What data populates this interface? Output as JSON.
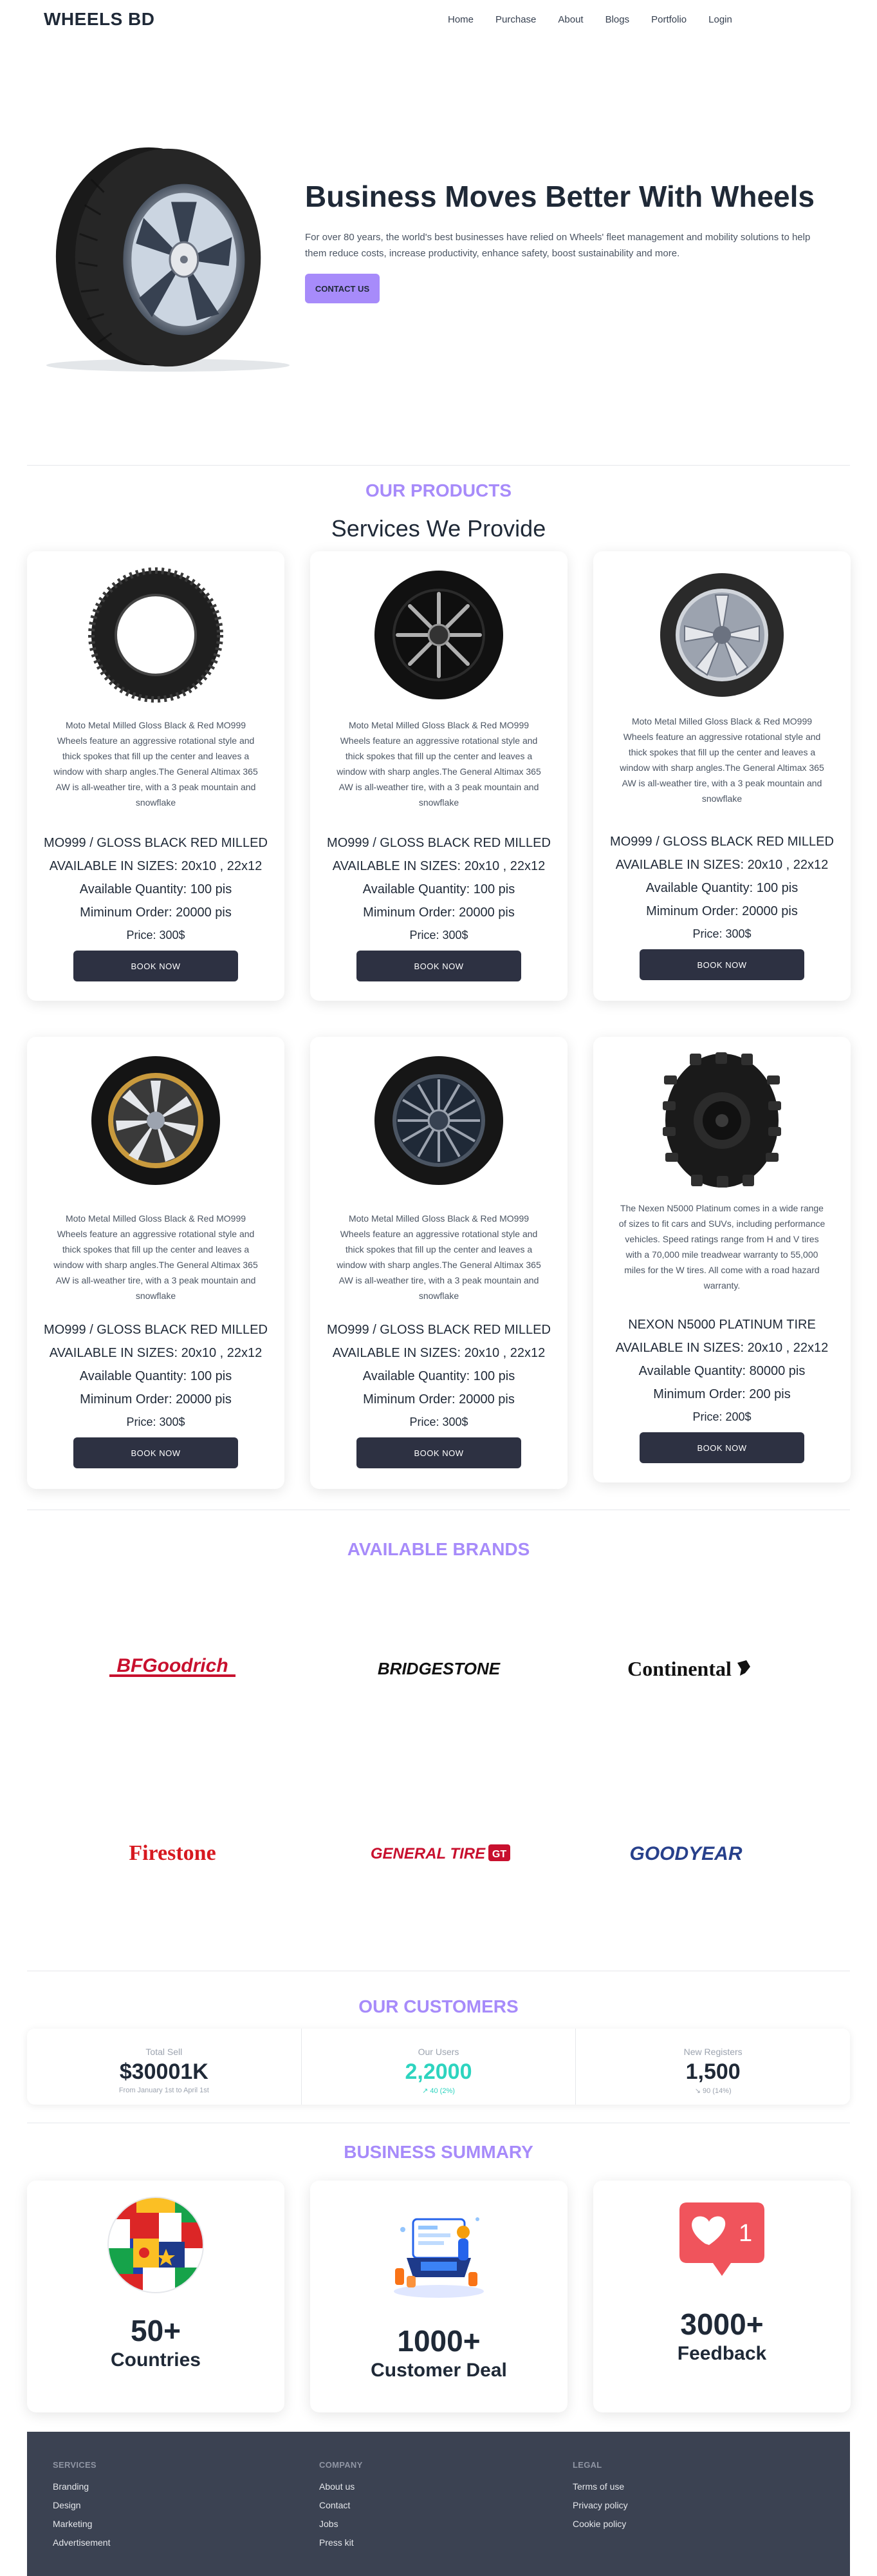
{
  "navbar": {
    "brand": "WHEELS BD",
    "links": [
      "Home",
      "Purchase",
      "About",
      "Blogs",
      "Portfolio",
      "Login"
    ]
  },
  "hero": {
    "title": "Business Moves Better With Wheels",
    "description": "For over 80 years, the world's best businesses have relied on Wheels' fleet management and mobility solutions to help them reduce costs, increase productivity, enhance safety, boost sustainability and more.",
    "cta": "CONTACT US"
  },
  "products": {
    "heading": "OUR PRODUCTS",
    "subheading": "Services We Provide",
    "items": [
      {
        "image": "tire-plain",
        "description": "Moto Metal Milled Gloss Black & Red MO999 Wheels feature an aggressive rotational style and thick spokes that fill up the center and leaves a window with sharp angles.The General Altimax 365 AW is all-weather tire, with a 3 peak mountain and snowflake",
        "name": "MO999 / GLOSS BLACK RED MILLED",
        "sizes": "AVAILABLE IN SIZES: 20x10 , 22x12",
        "quantity": "Available Quantity: 100 pis",
        "min_order": "Miminum Order: 20000 pis",
        "price": "Price: 300$",
        "button": "BOOK NOW"
      },
      {
        "image": "tire-black-alloy",
        "description": "Moto Metal Milled Gloss Black & Red MO999 Wheels feature an aggressive rotational style and thick spokes that fill up the center and leaves a window with sharp angles.The General Altimax 365 AW is all-weather tire, with a 3 peak mountain and snowflake",
        "name": "MO999 / GLOSS BLACK RED MILLED",
        "sizes": "AVAILABLE IN SIZES: 20x10 , 22x12",
        "quantity": "Available Quantity: 100 pis",
        "min_order": "Miminum Order: 20000 pis",
        "price": "Price: 300$",
        "button": "BOOK NOW"
      },
      {
        "image": "tire-silver-alloy",
        "description": "Moto Metal Milled Gloss Black & Red MO999 Wheels feature an aggressive rotational style and thick spokes that fill up the center and leaves a window with sharp angles.The General Altimax 365 AW is all-weather tire, with a 3 peak mountain and snowflake",
        "name": "MO999 / GLOSS BLACK RED MILLED",
        "sizes": "AVAILABLE IN SIZES: 20x10 , 22x12",
        "quantity": "Available Quantity: 100 pis",
        "min_order": "Miminum Order: 20000 pis",
        "price": "Price: 300$",
        "button": "BOOK NOW"
      },
      {
        "image": "tire-gold-rim",
        "description": "Moto Metal Milled Gloss Black & Red MO999 Wheels feature an aggressive rotational style and thick spokes that fill up the center and leaves a window with sharp angles.The General Altimax 365 AW is all-weather tire, with a 3 peak mountain and snowflake",
        "name": "MO999 / GLOSS BLACK RED MILLED",
        "sizes": "AVAILABLE IN SIZES: 20x10 , 22x12",
        "quantity": "Available Quantity: 100 pis",
        "min_order": "Miminum Order: 20000 pis",
        "price": "Price: 300$",
        "button": "BOOK NOW"
      },
      {
        "image": "tire-dark-spoke",
        "description": "Moto Metal Milled Gloss Black & Red MO999 Wheels feature an aggressive rotational style and thick spokes that fill up the center and leaves a window with sharp angles.The General Altimax 365 AW is all-weather tire, with a 3 peak mountain and snowflake",
        "name": "MO999 / GLOSS BLACK RED MILLED",
        "sizes": "AVAILABLE IN SIZES: 20x10 , 22x12",
        "quantity": "Available Quantity: 100 pis",
        "min_order": "Miminum Order: 20000 pis",
        "price": "Price: 300$",
        "button": "BOOK NOW"
      },
      {
        "image": "tire-offroad",
        "description": "The Nexen N5000 Platinum comes in a wide range of sizes to fit cars and SUVs, including performance vehicles. Speed ratings range from H and V tires with a 70,000 mile treadwear warranty to 55,000 miles for the W tires. All come with a road hazard warranty.",
        "name": "NEXON N5000 PLATINUM TIRE",
        "sizes": "AVAILABLE IN SIZES: 20x10 , 22x12",
        "quantity": "Available Quantity: 80000 pis",
        "min_order": "Minimum Order: 200 pis",
        "price": "Price: 200$",
        "button": "BOOK NOW"
      }
    ]
  },
  "brands": {
    "heading": "AVAILABLE BRANDS",
    "items": [
      {
        "name": "BFGoodrich",
        "color": "#c8102e"
      },
      {
        "name": "BRIDGESTONE",
        "color": "#111111"
      },
      {
        "name": "Continental",
        "color": "#111111"
      },
      {
        "name": "Firestone",
        "color": "#d71920"
      },
      {
        "name": "GENERAL TIRE",
        "color": "#c8102e"
      },
      {
        "name": "GOODYEAR",
        "color": "#27408b"
      }
    ]
  },
  "customers": {
    "heading": "OUR CUSTOMERS",
    "stats": [
      {
        "title": "Total Sell",
        "value": "$30001K",
        "desc": "From January 1st to April 1st",
        "color": "#1f2937"
      },
      {
        "title": "Our Users",
        "value": "2,2000",
        "desc": "↗︎ 40 (2%)",
        "color": "#2dd4bf"
      },
      {
        "title": "New Registers",
        "value": "1,500",
        "desc": "↘︎ 90 (14%)",
        "color": "#1f2937"
      }
    ]
  },
  "summary": {
    "heading": "BUSINESS SUMMARY",
    "items": [
      {
        "number": "50+",
        "label": "Countries",
        "icon": "flag-globe-icon"
      },
      {
        "number": "1000+",
        "label": "Customer Deal",
        "icon": "business-deal-icon"
      },
      {
        "number": "3000+",
        "label": "Feedback",
        "icon": "heart-notification-icon",
        "badge": "1"
      }
    ]
  },
  "footer": {
    "columns": [
      {
        "title": "SERVICES",
        "links": [
          "Branding",
          "Design",
          "Marketing",
          "Advertisement"
        ]
      },
      {
        "title": "COMPANY",
        "links": [
          "About us",
          "Contact",
          "Jobs",
          "Press kit"
        ]
      },
      {
        "title": "LEGAL",
        "links": [
          "Terms of use",
          "Privacy policy",
          "Cookie policy"
        ]
      }
    ]
  },
  "colors": {
    "accent": "#a78bfa",
    "dark_button": "#2d3142",
    "footer_bg": "#3b4252",
    "teal": "#2dd4bf"
  }
}
